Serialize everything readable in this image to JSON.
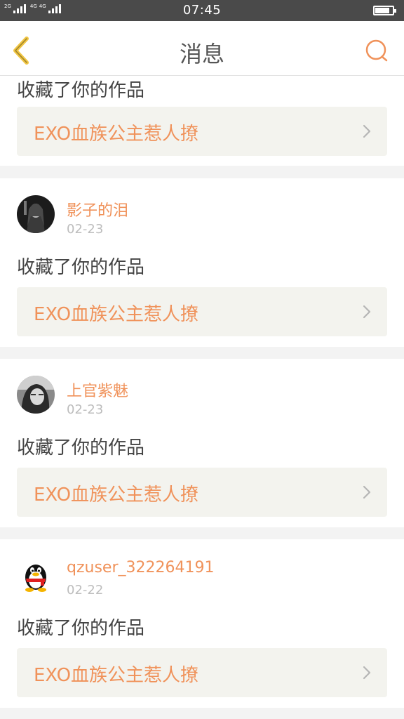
{
  "status_bar": {
    "network_labels": [
      "2G",
      "4G",
      "4G"
    ],
    "time": "07:45",
    "battery_level": 0.85
  },
  "header": {
    "title": "消息",
    "back_icon": "chevron-left-icon",
    "search_icon": "search-icon"
  },
  "feed": {
    "partial_item": {
      "action": "收藏了你的作品",
      "work_title": "EXO血族公主惹人撩"
    },
    "items": [
      {
        "user": "影子的泪",
        "date": "02-23",
        "action": "收藏了你的作品",
        "work_title": "EXO血族公主惹人撩"
      },
      {
        "user": "上官紫魅",
        "date": "02-23",
        "action": "收藏了你的作品",
        "work_title": "EXO血族公主惹人撩"
      },
      {
        "user": "qzuser_322264191",
        "date": "02-22",
        "action": "收藏了你的作品",
        "work_title": "EXO血族公主惹人撩"
      }
    ]
  },
  "colors": {
    "accent": "#f0925a",
    "back_icon": "#f0c542",
    "status_bar": "#4a4a4a",
    "card_inner": "#f3f3ee"
  }
}
